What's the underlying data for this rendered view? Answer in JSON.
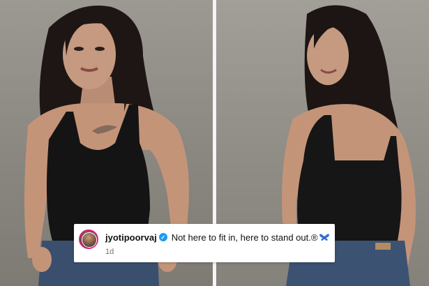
{
  "comment": {
    "username": "jyotipoorvaj",
    "text": "Not here to fit in, here to stand out.®",
    "timestamp": "1d",
    "verified_icon": "verified-badge-icon",
    "emoji_icon": "blue-butterfly-icon"
  },
  "colors": {
    "verified_blue": "#1d9bf0",
    "avatar_ring": "#d4217f",
    "timestamp_gray": "#737373"
  }
}
